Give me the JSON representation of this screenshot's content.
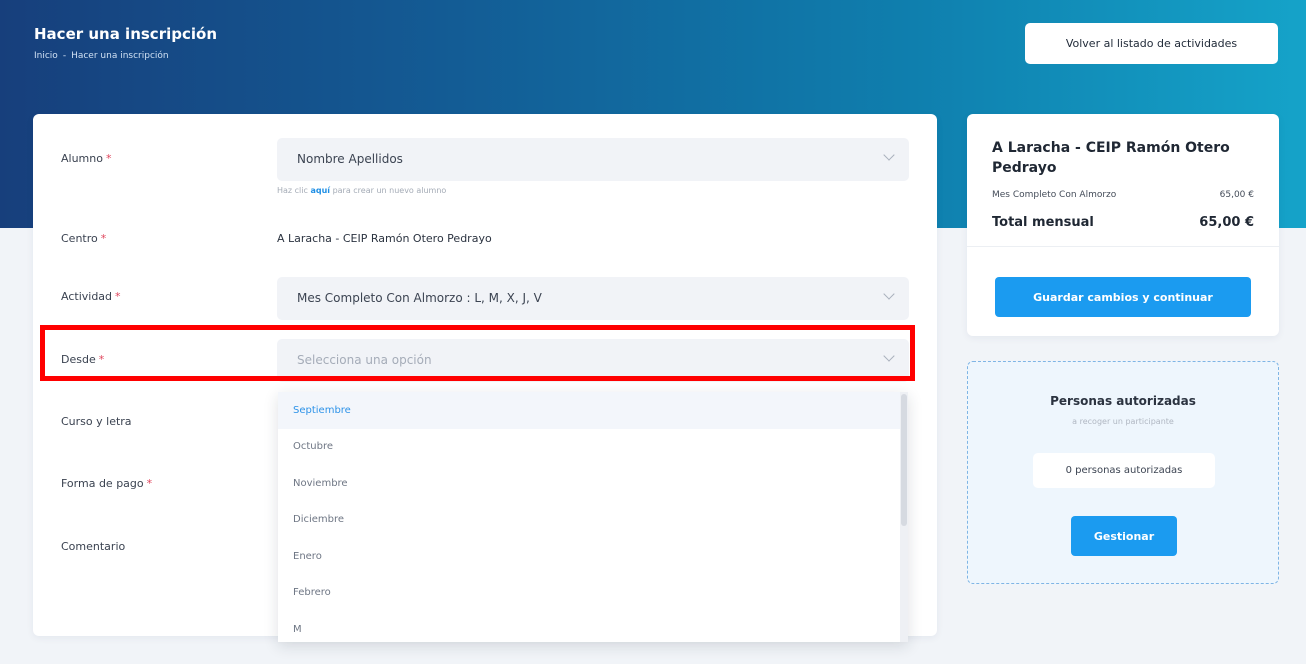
{
  "header": {
    "title": "Hacer una inscripción",
    "breadcrumb": [
      "Inicio",
      "Hacer una inscripción"
    ],
    "breadcrumb_sep": "-",
    "back_button": "Volver al listado de actividades"
  },
  "form": {
    "required_mark": "*",
    "alumno": {
      "label": "Alumno",
      "value": "Nombre Apellidos",
      "hint_prefix": "Haz clic",
      "hint_link": "aquí",
      "hint_suffix": "para crear un nuevo alumno"
    },
    "centro": {
      "label": "Centro",
      "value": "A Laracha - CEIP Ramón Otero Pedrayo"
    },
    "actividad": {
      "label": "Actividad",
      "value": "Mes Completo Con Almorzo : L, M, X, J, V"
    },
    "desde": {
      "label": "Desde",
      "placeholder": "Selecciona una opción",
      "options": [
        "Septiembre",
        "Octubre",
        "Noviembre",
        "Diciembre",
        "Enero",
        "Febrero",
        "M"
      ],
      "highlighted_option": "Septiembre"
    },
    "curso": {
      "label": "Curso y letra"
    },
    "forma_pago": {
      "label": "Forma de pago"
    },
    "comentario": {
      "label": "Comentario"
    }
  },
  "summary": {
    "title": "A Laracha - CEIP Ramón Otero Pedrayo",
    "line_label": "Mes Completo Con Almorzo",
    "line_price": "65,00 €",
    "total_label": "Total mensual",
    "total_price": "65,00 €",
    "save_button": "Guardar cambios y continuar"
  },
  "authorized": {
    "title": "Personas autorizadas",
    "subtitle": "a recoger un participante",
    "count_text": "0 personas autorizadas",
    "manage_button": "Gestionar"
  },
  "colors": {
    "accent": "#1b9bf0",
    "required": "#e0455c",
    "highlight_border": "#ff0000"
  }
}
